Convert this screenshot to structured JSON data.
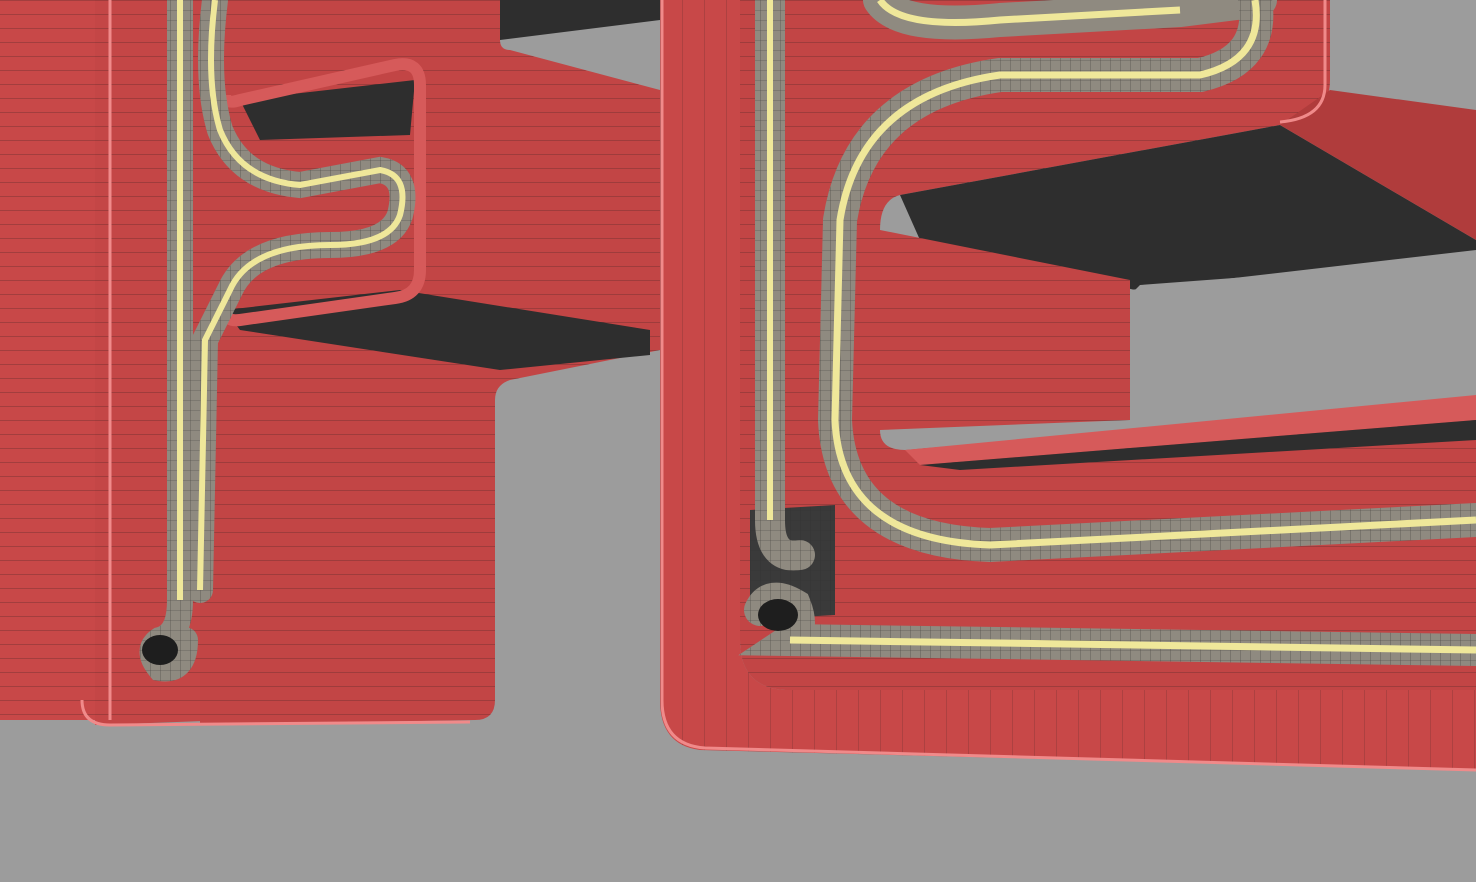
{
  "scene": {
    "kind": "3d-wireframe-render",
    "subject": "neon-sign-letter-model",
    "colors": {
      "background": "#9c9c9c",
      "letter_face": "#c84848",
      "letter_side": "#b03c3c",
      "letter_top": "#d65a5a",
      "shadow": "#2e2e2e",
      "wire": "#1a1a1a",
      "tube_outer": "#8f8a80",
      "tube_core": "#efe79a",
      "highlight": "#f08a8a",
      "mount_block": "#3a3a3a"
    },
    "objects": [
      {
        "name": "letter-left",
        "type": "extruded-letter"
      },
      {
        "name": "letter-right",
        "type": "extruded-letter"
      },
      {
        "name": "neon-tube-left",
        "type": "tube"
      },
      {
        "name": "neon-tube-right-upper",
        "type": "tube"
      },
      {
        "name": "neon-tube-right-lower",
        "type": "tube"
      },
      {
        "name": "mount-block",
        "type": "bracket"
      }
    ]
  }
}
